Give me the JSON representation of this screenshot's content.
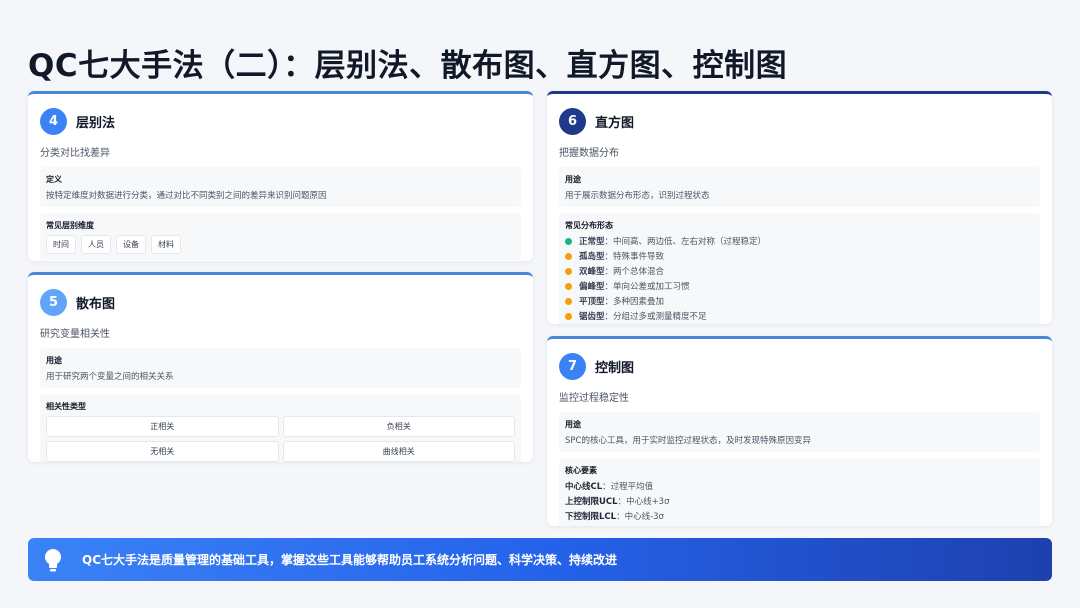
{
  "title": "QC七大手法（二）：层别法、散布图、直方图、控制图",
  "cards": {
    "c4": {
      "number": "4",
      "title": "层别法",
      "subtitle": "分类对比找差异",
      "definition_label": "定义",
      "definition_text": "按特定维度对数据进行分类，通过对比不同类别之间的差异来识别问题原因",
      "dimensions_label": "常见层别维度",
      "dimensions": [
        "时间",
        "人员",
        "设备",
        "材料"
      ]
    },
    "c5": {
      "number": "5",
      "title": "散布图",
      "subtitle": "研究变量相关性",
      "usage_label": "用途",
      "usage_text": "用于研究两个变量之间的相关关系",
      "types_label": "相关性类型",
      "types": [
        "正相关",
        "负相关",
        "无相关",
        "曲线相关"
      ]
    },
    "c6": {
      "number": "6",
      "title": "直方图",
      "subtitle": "把握数据分布",
      "usage_label": "用途",
      "usage_text": "用于展示数据分布形态，识别过程状态",
      "shapes_label": "常见分布形态",
      "shapes": [
        {
          "name": "正常型",
          "desc": "：中间高、两边低、左右对称（过程稳定）",
          "color": "#10b981"
        },
        {
          "name": "孤岛型",
          "desc": "：特殊事件导致",
          "color": "#f59e0b"
        },
        {
          "name": "双峰型",
          "desc": "：两个总体混合",
          "color": "#f59e0b"
        },
        {
          "name": "偏峰型",
          "desc": "：单向公差或加工习惯",
          "color": "#f59e0b"
        },
        {
          "name": "平顶型",
          "desc": "：多种因素叠加",
          "color": "#f59e0b"
        },
        {
          "name": "锯齿型",
          "desc": "：分组过多或测量精度不足",
          "color": "#f59e0b"
        }
      ]
    },
    "c7": {
      "number": "7",
      "title": "控制图",
      "subtitle": "监控过程稳定性",
      "usage_label": "用途",
      "usage_text": "SPC的核心工具，用于实时监控过程状态，及时发现特殊原因变异",
      "elements_label": "核心要素",
      "elements": [
        {
          "name": "中心线CL",
          "desc": "：过程平均值"
        },
        {
          "name": "上控制限UCL",
          "desc": "：中心线+3σ"
        },
        {
          "name": "下控制限LCL",
          "desc": "：中心线-3σ"
        }
      ]
    }
  },
  "banner": {
    "icon": "lightbulb-icon",
    "text": "QC七大手法是质量管理的基础工具，掌握这些工具能够帮助员工系统分析问题、科学决策、持续改进"
  }
}
